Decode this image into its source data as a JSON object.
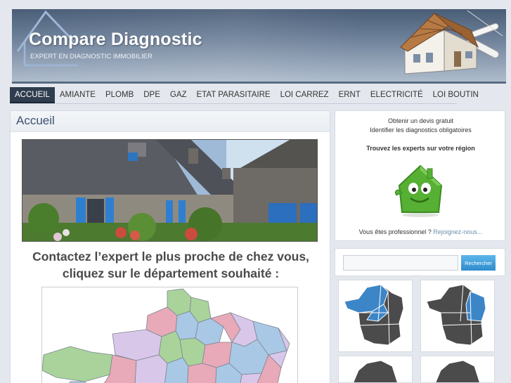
{
  "header": {
    "title": "Compare Diagnostic",
    "tagline": "EXPERT EN DIAGNOSTIC IMMOBILIER"
  },
  "nav": [
    {
      "label": "ACCUEIL",
      "active": true
    },
    {
      "label": "AMIANTE"
    },
    {
      "label": "PLOMB"
    },
    {
      "label": "DPE"
    },
    {
      "label": "GAZ"
    },
    {
      "label": "ETAT PARASITAIRE"
    },
    {
      "label": "LOI CARREZ"
    },
    {
      "label": "ERNT"
    },
    {
      "label": "ELECTRICITÉ"
    },
    {
      "label": "LOI BOUTIN"
    }
  ],
  "main": {
    "title": "Accueil",
    "contact_line1": "Contactez l’expert le plus proche de chez vous,",
    "contact_line2": "cliquez sur le département souhaité :"
  },
  "sidebar": {
    "quote_link": "Obtenir un devis gratuit",
    "identify_link": "Identifier les diagnostics obligatoires",
    "find_experts": "Trouvez les experts sur votre région",
    "pro_text": "Vous êtes professionnel ?",
    "join_link": "Rejoignez-nous...",
    "search_button": "Rechercher",
    "search_value": ""
  },
  "colors": {
    "accent_blue": "#2f8ccc",
    "nav_active": "#2f3d4e",
    "map_highlight": "#3c86c8",
    "title_blue": "#3d5270"
  }
}
